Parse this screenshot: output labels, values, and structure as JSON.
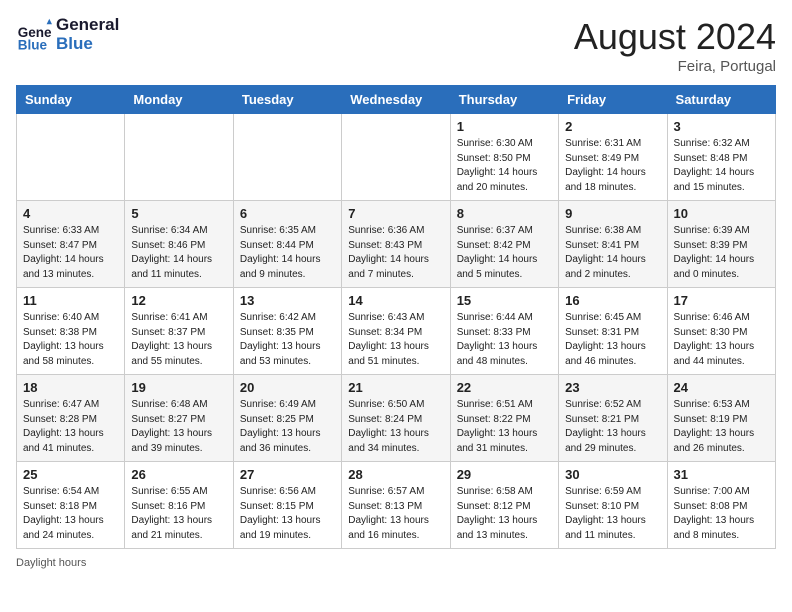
{
  "header": {
    "logo_line1": "General",
    "logo_line2": "Blue",
    "month_year": "August 2024",
    "location": "Feira, Portugal"
  },
  "days_of_week": [
    "Sunday",
    "Monday",
    "Tuesday",
    "Wednesday",
    "Thursday",
    "Friday",
    "Saturday"
  ],
  "weeks": [
    [
      {
        "day": "",
        "sunrise": "",
        "sunset": "",
        "daylight": ""
      },
      {
        "day": "",
        "sunrise": "",
        "sunset": "",
        "daylight": ""
      },
      {
        "day": "",
        "sunrise": "",
        "sunset": "",
        "daylight": ""
      },
      {
        "day": "",
        "sunrise": "",
        "sunset": "",
        "daylight": ""
      },
      {
        "day": "1",
        "sunrise": "6:30 AM",
        "sunset": "8:50 PM",
        "daylight": "14 hours and 20 minutes."
      },
      {
        "day": "2",
        "sunrise": "6:31 AM",
        "sunset": "8:49 PM",
        "daylight": "14 hours and 18 minutes."
      },
      {
        "day": "3",
        "sunrise": "6:32 AM",
        "sunset": "8:48 PM",
        "daylight": "14 hours and 15 minutes."
      }
    ],
    [
      {
        "day": "4",
        "sunrise": "6:33 AM",
        "sunset": "8:47 PM",
        "daylight": "14 hours and 13 minutes."
      },
      {
        "day": "5",
        "sunrise": "6:34 AM",
        "sunset": "8:46 PM",
        "daylight": "14 hours and 11 minutes."
      },
      {
        "day": "6",
        "sunrise": "6:35 AM",
        "sunset": "8:44 PM",
        "daylight": "14 hours and 9 minutes."
      },
      {
        "day": "7",
        "sunrise": "6:36 AM",
        "sunset": "8:43 PM",
        "daylight": "14 hours and 7 minutes."
      },
      {
        "day": "8",
        "sunrise": "6:37 AM",
        "sunset": "8:42 PM",
        "daylight": "14 hours and 5 minutes."
      },
      {
        "day": "9",
        "sunrise": "6:38 AM",
        "sunset": "8:41 PM",
        "daylight": "14 hours and 2 minutes."
      },
      {
        "day": "10",
        "sunrise": "6:39 AM",
        "sunset": "8:39 PM",
        "daylight": "14 hours and 0 minutes."
      }
    ],
    [
      {
        "day": "11",
        "sunrise": "6:40 AM",
        "sunset": "8:38 PM",
        "daylight": "13 hours and 58 minutes."
      },
      {
        "day": "12",
        "sunrise": "6:41 AM",
        "sunset": "8:37 PM",
        "daylight": "13 hours and 55 minutes."
      },
      {
        "day": "13",
        "sunrise": "6:42 AM",
        "sunset": "8:35 PM",
        "daylight": "13 hours and 53 minutes."
      },
      {
        "day": "14",
        "sunrise": "6:43 AM",
        "sunset": "8:34 PM",
        "daylight": "13 hours and 51 minutes."
      },
      {
        "day": "15",
        "sunrise": "6:44 AM",
        "sunset": "8:33 PM",
        "daylight": "13 hours and 48 minutes."
      },
      {
        "day": "16",
        "sunrise": "6:45 AM",
        "sunset": "8:31 PM",
        "daylight": "13 hours and 46 minutes."
      },
      {
        "day": "17",
        "sunrise": "6:46 AM",
        "sunset": "8:30 PM",
        "daylight": "13 hours and 44 minutes."
      }
    ],
    [
      {
        "day": "18",
        "sunrise": "6:47 AM",
        "sunset": "8:28 PM",
        "daylight": "13 hours and 41 minutes."
      },
      {
        "day": "19",
        "sunrise": "6:48 AM",
        "sunset": "8:27 PM",
        "daylight": "13 hours and 39 minutes."
      },
      {
        "day": "20",
        "sunrise": "6:49 AM",
        "sunset": "8:25 PM",
        "daylight": "13 hours and 36 minutes."
      },
      {
        "day": "21",
        "sunrise": "6:50 AM",
        "sunset": "8:24 PM",
        "daylight": "13 hours and 34 minutes."
      },
      {
        "day": "22",
        "sunrise": "6:51 AM",
        "sunset": "8:22 PM",
        "daylight": "13 hours and 31 minutes."
      },
      {
        "day": "23",
        "sunrise": "6:52 AM",
        "sunset": "8:21 PM",
        "daylight": "13 hours and 29 minutes."
      },
      {
        "day": "24",
        "sunrise": "6:53 AM",
        "sunset": "8:19 PM",
        "daylight": "13 hours and 26 minutes."
      }
    ],
    [
      {
        "day": "25",
        "sunrise": "6:54 AM",
        "sunset": "8:18 PM",
        "daylight": "13 hours and 24 minutes."
      },
      {
        "day": "26",
        "sunrise": "6:55 AM",
        "sunset": "8:16 PM",
        "daylight": "13 hours and 21 minutes."
      },
      {
        "day": "27",
        "sunrise": "6:56 AM",
        "sunset": "8:15 PM",
        "daylight": "13 hours and 19 minutes."
      },
      {
        "day": "28",
        "sunrise": "6:57 AM",
        "sunset": "8:13 PM",
        "daylight": "13 hours and 16 minutes."
      },
      {
        "day": "29",
        "sunrise": "6:58 AM",
        "sunset": "8:12 PM",
        "daylight": "13 hours and 13 minutes."
      },
      {
        "day": "30",
        "sunrise": "6:59 AM",
        "sunset": "8:10 PM",
        "daylight": "13 hours and 11 minutes."
      },
      {
        "day": "31",
        "sunrise": "7:00 AM",
        "sunset": "8:08 PM",
        "daylight": "13 hours and 8 minutes."
      }
    ]
  ],
  "footer": {
    "note": "Daylight hours"
  }
}
